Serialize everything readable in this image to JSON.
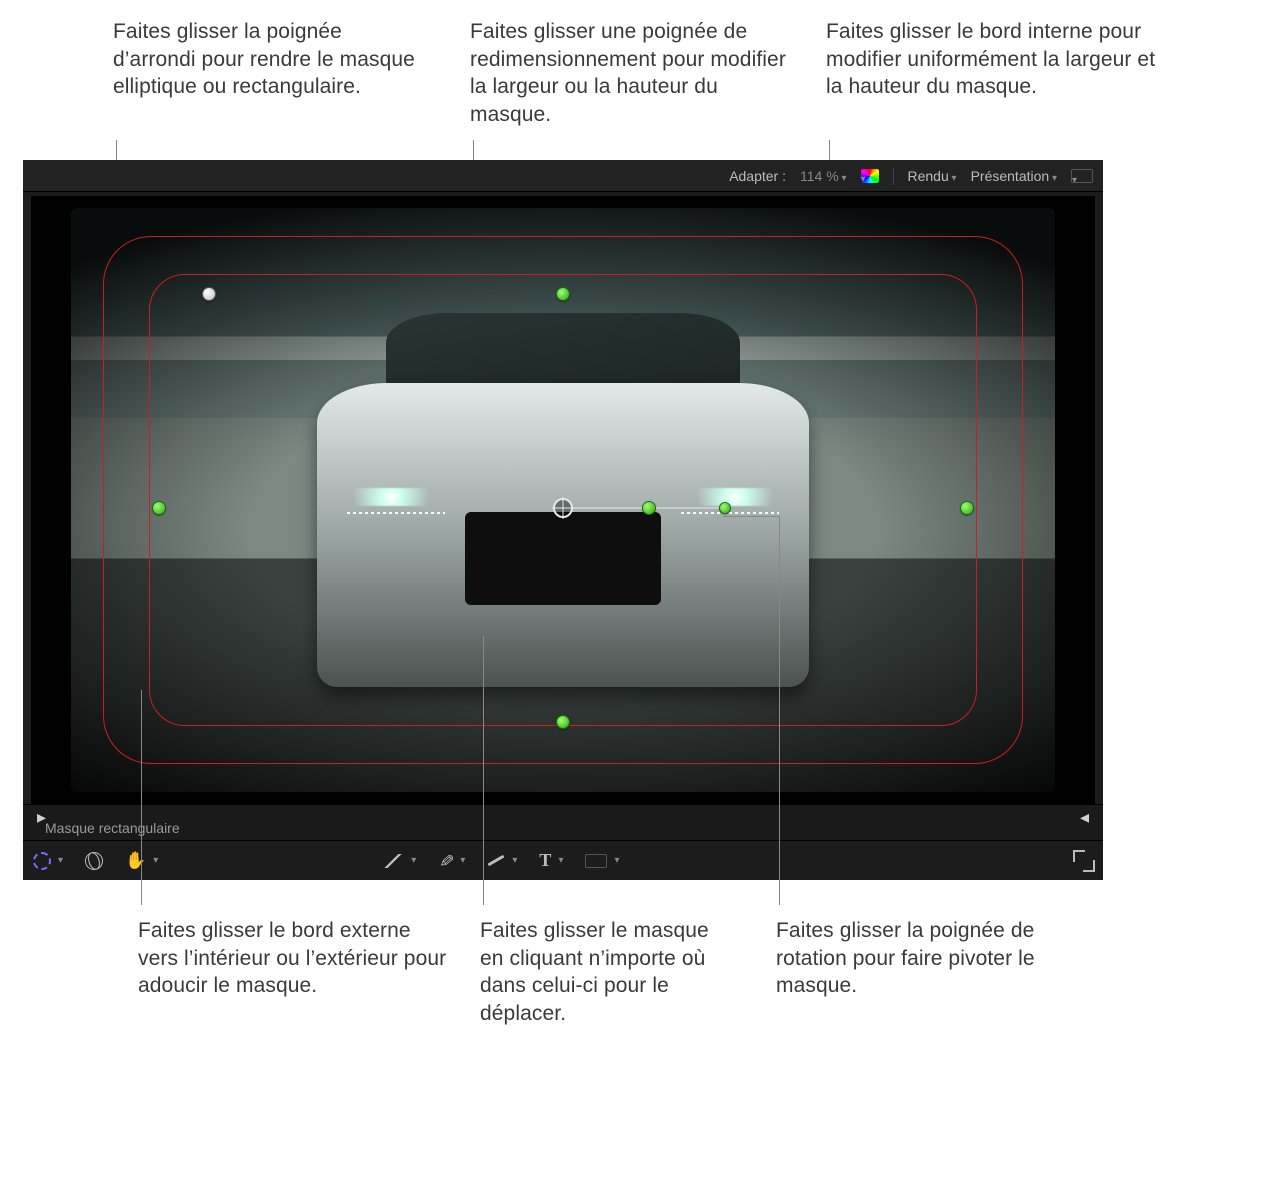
{
  "callouts": {
    "round_handle": "Faites glisser la poignée d’arrondi pour rendre le masque elliptique ou rectangulaire.",
    "resize_handle": "Faites glisser une poignée de redimensionnement pour modifier la largeur ou la hauteur du masque.",
    "inner_edge": "Faites glisser le bord interne pour modifier uniformément la largeur et la hauteur du masque.",
    "outer_edge": "Faites glisser le bord externe vers l’intérieur ou l’extérieur pour adoucir le masque.",
    "move_mask": "Faites glisser le masque en cliquant n’importe où dans celui-ci pour le déplacer.",
    "rotate_handle": "Faites glisser la poignée de rotation pour faire pivoter le masque."
  },
  "topbar": {
    "fit_label": "Adapter :",
    "fit_value": "114 %",
    "render_label": "Rendu",
    "view_label": "Présentation"
  },
  "mask_name": "Masque rectangulaire",
  "toolbar_text_glyph": "T",
  "icons": {
    "mask_shape": "mask-shape-icon",
    "globe": "globe-icon",
    "hand": "hand-icon",
    "line": "line-icon",
    "pen": "pen-icon",
    "brush": "brush-icon",
    "text": "text-icon",
    "rect": "rect-icon",
    "expand": "expand-icon",
    "hue": "hue-swatch",
    "aspect": "aspect-swatch"
  }
}
